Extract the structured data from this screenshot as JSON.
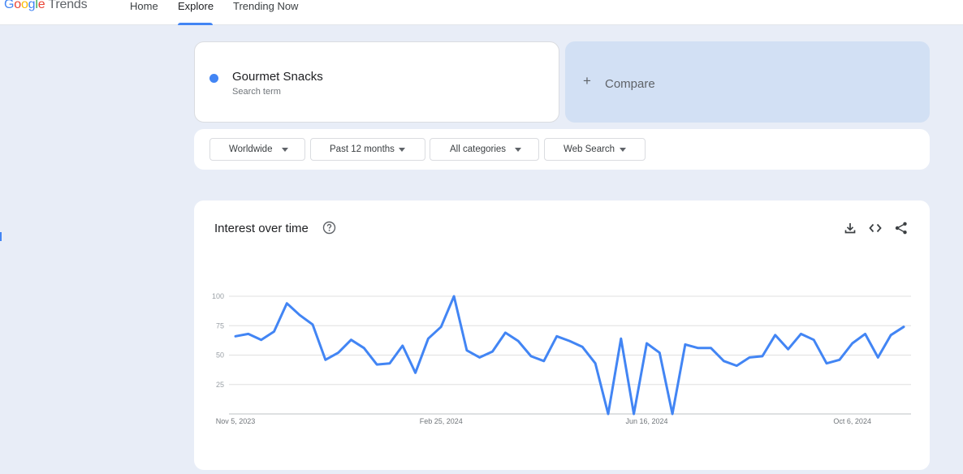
{
  "header": {
    "logo_google": "Google",
    "logo_trends": "Trends",
    "nav": [
      {
        "label": "Home"
      },
      {
        "label": "Explore"
      },
      {
        "label": "Trending Now"
      }
    ],
    "active_tab": "Explore"
  },
  "search": {
    "term": "Gourmet Snacks",
    "term_sub": "Search term",
    "term_color": "#4285f4",
    "compare_label": "Compare"
  },
  "filters": {
    "region": "Worldwide",
    "time_range": "Past 12 months",
    "category": "All categories",
    "search_type": "Web Search"
  },
  "chart_card": {
    "title": "Interest over time",
    "icons": [
      "help-icon",
      "download-icon",
      "embed-icon",
      "share-icon"
    ]
  },
  "chart_data": {
    "type": "line",
    "ylim": [
      0,
      100
    ],
    "yticks": [
      25,
      50,
      75,
      100
    ],
    "x_tick_labels": [
      "Nov 5, 2023",
      "Feb 25, 2024",
      "Jun 16, 2024",
      "Oct 6, 2024"
    ],
    "x_tick_indices": [
      0,
      16,
      32,
      48
    ],
    "grid": true,
    "series": [
      {
        "color": "#4285f4",
        "values": [
          66,
          68,
          63,
          70,
          94,
          84,
          76,
          46,
          52,
          63,
          56,
          42,
          43,
          58,
          35,
          64,
          74,
          100,
          54,
          48,
          53,
          69,
          62,
          49,
          45,
          66,
          62,
          57,
          43,
          0,
          64,
          0,
          60,
          52,
          0,
          59,
          56,
          56,
          45,
          41,
          48,
          49,
          67,
          55,
          68,
          63,
          43,
          46,
          60,
          68,
          48,
          67,
          74
        ]
      }
    ]
  }
}
